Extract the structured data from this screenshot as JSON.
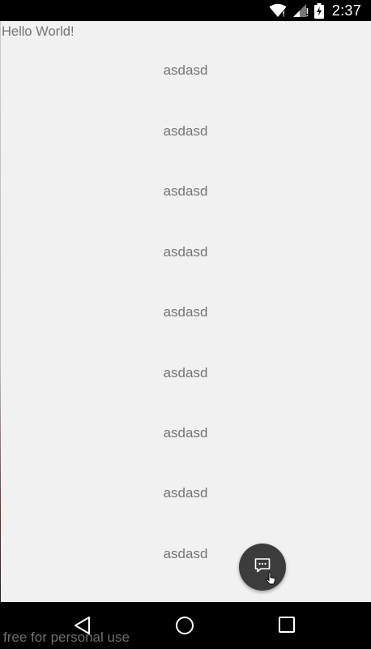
{
  "status_bar": {
    "time": "2:37",
    "icons": [
      "wifi-icon",
      "cell-signal-icon",
      "battery-charging-icon"
    ]
  },
  "content": {
    "hello_text": "Hello World!",
    "list_items": [
      "asdasd",
      "asdasd",
      "asdasd",
      "asdasd",
      "asdasd",
      "asdasd",
      "asdasd",
      "asdasd",
      "asdasd"
    ]
  },
  "fab": {
    "icon": "chat-bubble-icon",
    "color": "#3c3c3c"
  },
  "nav_bar": {
    "buttons": [
      "back-icon",
      "home-icon",
      "recents-icon"
    ]
  },
  "watermark": "free for personal use",
  "colors": {
    "background": "#f1f1f1",
    "text": "#757575",
    "bars": "#000000"
  }
}
